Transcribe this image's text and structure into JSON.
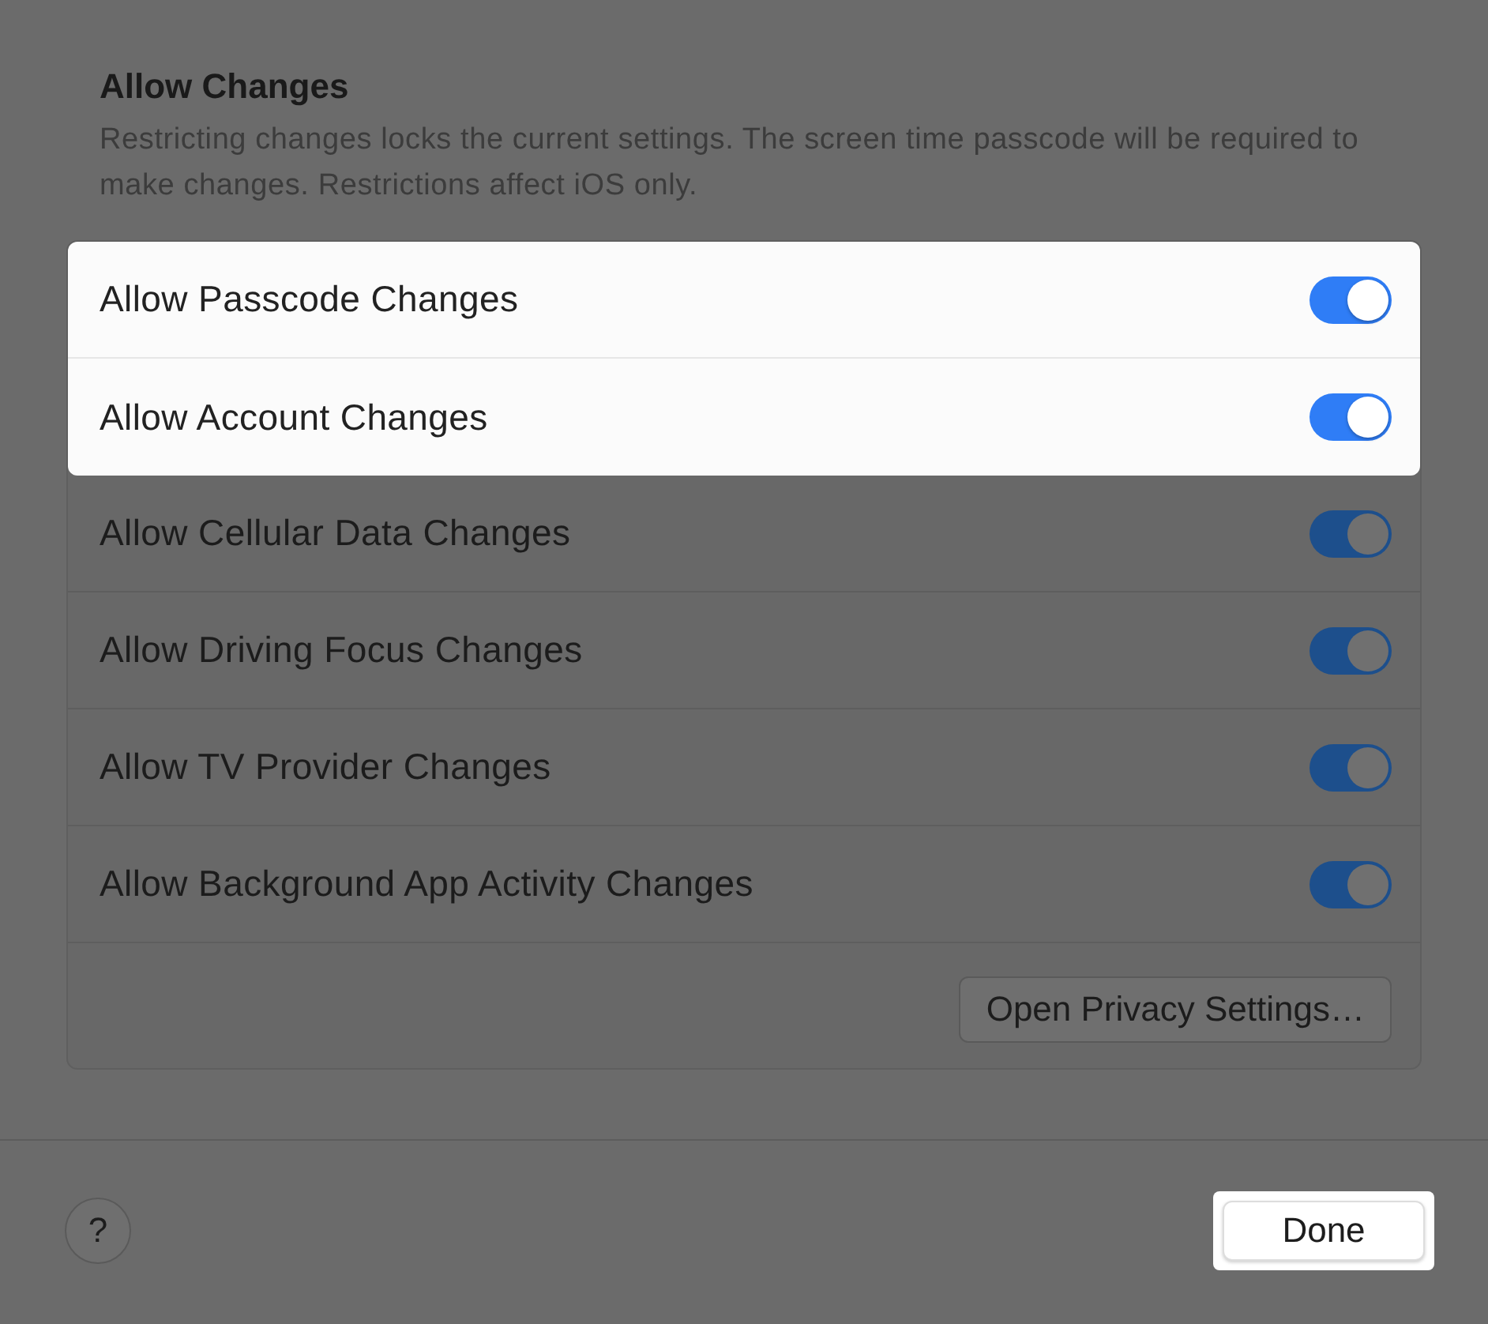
{
  "section": {
    "title": "Allow Changes",
    "description": "Restricting changes locks the current settings. The screen time passcode will be required to make changes. Restrictions affect iOS only."
  },
  "rows": [
    {
      "label": "Allow Passcode Changes",
      "on": true,
      "highlighted": true
    },
    {
      "label": "Allow Account Changes",
      "on": true,
      "highlighted": true
    },
    {
      "label": "Allow Cellular Data Changes",
      "on": true,
      "highlighted": false
    },
    {
      "label": "Allow Driving Focus Changes",
      "on": true,
      "highlighted": false
    },
    {
      "label": "Allow TV Provider Changes",
      "on": true,
      "highlighted": false
    },
    {
      "label": "Allow Background App Activity Changes",
      "on": true,
      "highlighted": false
    }
  ],
  "privacy_button": {
    "label": "Open Privacy Settings…",
    "highlighted": false
  },
  "help_button": {
    "label": "?",
    "highlighted": false
  },
  "done_button": {
    "label": "Done",
    "highlighted": true
  }
}
